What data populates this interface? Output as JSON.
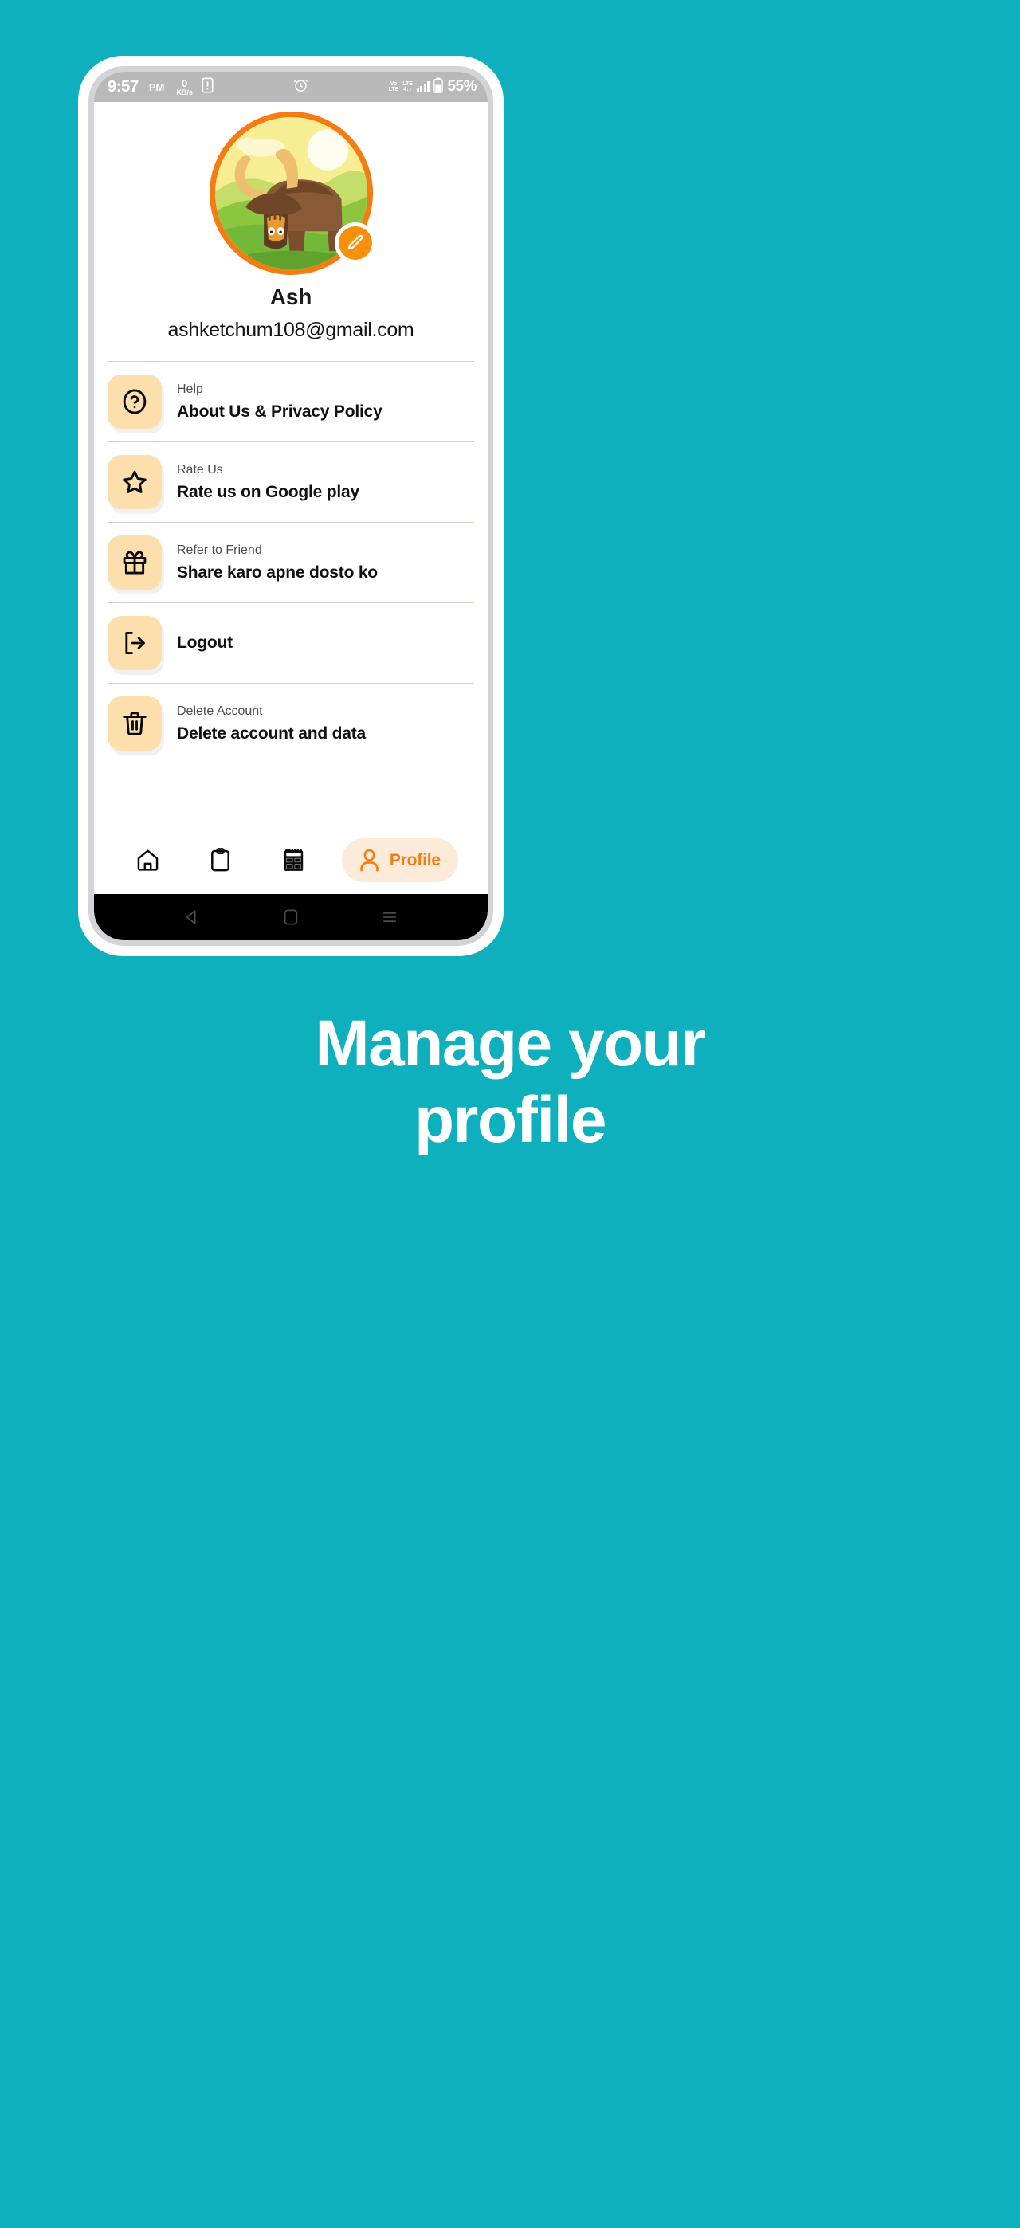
{
  "theme": {
    "background_teal": "#0DB0BC",
    "accent_orange": "#F57C12",
    "icon_tile_peach": "#FDDFAE",
    "active_pill_peach": "#FDEBD9"
  },
  "status_bar": {
    "time": "9:57",
    "ampm": "PM",
    "net_speed_value": "0",
    "net_speed_unit": "KB/s",
    "sim_icon": "sim-alert-icon",
    "alarm_icon": "alarm-clock-icon",
    "volte_line1": "Vo",
    "volte_line2": "LTE",
    "lte_line1": "LTE",
    "lte_line2": "4↓↑",
    "battery_percent": "55%"
  },
  "profile": {
    "avatar_alt": "buffalo-avatar",
    "edit_icon": "pencil-icon",
    "name": "Ash",
    "email": "ashketchum108@gmail.com"
  },
  "menu": {
    "items": [
      {
        "icon": "help-circle-icon",
        "subtitle": "Help",
        "title": "About Us & Privacy Policy"
      },
      {
        "icon": "star-icon",
        "subtitle": "Rate Us",
        "title": "Rate us on Google play"
      },
      {
        "icon": "gift-icon",
        "subtitle": "Refer to Friend",
        "title": "Share karo apne dosto ko"
      },
      {
        "icon": "logout-icon",
        "subtitle": "",
        "title": "Logout"
      },
      {
        "icon": "trash-icon",
        "subtitle": "Delete Account",
        "title": "Delete account and data"
      }
    ]
  },
  "bottom_nav": {
    "items": [
      {
        "icon": "home-icon",
        "label": "",
        "active": false
      },
      {
        "icon": "clipboard-icon",
        "label": "",
        "active": false
      },
      {
        "icon": "receipt-icon",
        "label": "",
        "active": false
      },
      {
        "icon": "person-icon",
        "label": "Profile",
        "active": true
      }
    ]
  },
  "android_nav": {
    "back_icon": "back-triangle-icon",
    "home_icon": "home-square-icon",
    "recents_icon": "recents-menu-icon"
  },
  "caption": {
    "line1": "Manage your",
    "line2": "profile"
  }
}
